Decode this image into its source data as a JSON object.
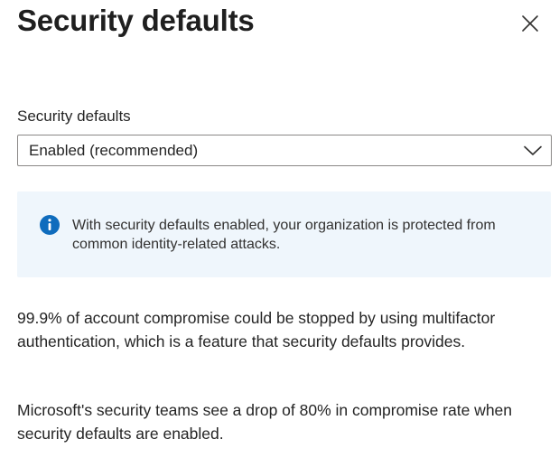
{
  "panel": {
    "title": "Security defaults",
    "close_icon": "close-icon"
  },
  "setting": {
    "label": "Security defaults",
    "selected_value": "Enabled (recommended)",
    "dropdown_icon": "chevron-down-icon"
  },
  "info_banner": {
    "icon": "info-icon",
    "text": "With security defaults enabled, your organization is protected from common identity-related attacks.",
    "color": "#eff6fc",
    "icon_color": "#0f6cbd"
  },
  "description": {
    "paragraph_1": "99.9% of account compromise could be stopped by using multifactor authentication, which is a feature that security defaults provides.",
    "paragraph_2": "Microsoft's security teams see a drop of 80% in compromise rate when security defaults are enabled."
  }
}
